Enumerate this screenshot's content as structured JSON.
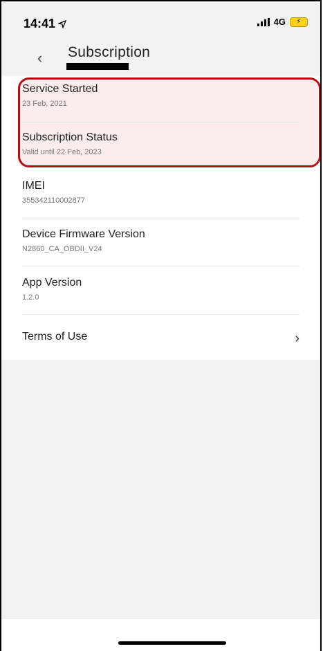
{
  "status_bar": {
    "time": "14:41",
    "network": "4G"
  },
  "nav": {
    "title": "Subscription"
  },
  "items": [
    {
      "label": "Service Started",
      "value": "23 Feb, 2021"
    },
    {
      "label": "Subscription Status",
      "value": "Valid until 22 Feb, 2023"
    },
    {
      "label": "IMEI",
      "value": "355342110002877"
    },
    {
      "label": "Device Firmware Version",
      "value": "N2860_CA_OBDII_V24"
    },
    {
      "label": "App Version",
      "value": "1.2.0"
    },
    {
      "label": "Terms of Use"
    }
  ],
  "icons": {
    "back": "chevron-left-icon",
    "terms": "chevron-right-icon",
    "location": "location-arrow-icon",
    "signal": "signal-bars-icon",
    "battery": "battery-charging-icon"
  },
  "colors": {
    "highlight_border": "#b40d14",
    "highlight_fill": "#fdecec",
    "battery": "#ffd21f"
  }
}
